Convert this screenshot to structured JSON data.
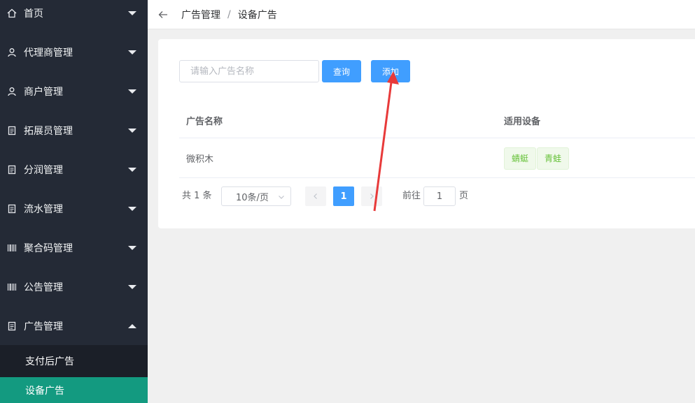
{
  "sidebar": {
    "items": [
      {
        "label": "首页",
        "icon": "home-icon",
        "expanded": false
      },
      {
        "label": "代理商管理",
        "icon": "user-icon",
        "expanded": false
      },
      {
        "label": "商户管理",
        "icon": "user-icon",
        "expanded": false
      },
      {
        "label": "拓展员管理",
        "icon": "document-icon",
        "expanded": false
      },
      {
        "label": "分润管理",
        "icon": "document-icon",
        "expanded": false
      },
      {
        "label": "流水管理",
        "icon": "document-icon",
        "expanded": false
      },
      {
        "label": "聚合码管理",
        "icon": "barcode-icon",
        "expanded": false
      },
      {
        "label": "公告管理",
        "icon": "barcode-icon",
        "expanded": false
      },
      {
        "label": "广告管理",
        "icon": "document-icon",
        "expanded": true
      }
    ],
    "subitems": [
      {
        "label": "支付后广告",
        "active": false
      },
      {
        "label": "设备广告",
        "active": true
      }
    ]
  },
  "header": {
    "breadcrumb": [
      "广告管理",
      "设备广告"
    ],
    "separator": "/"
  },
  "toolbar": {
    "search_placeholder": "请输入广告名称",
    "search_value": "",
    "query_label": "查询",
    "add_label": "添加"
  },
  "table": {
    "columns": [
      "广告名称",
      "适用设备"
    ],
    "rows": [
      {
        "name": "微积木",
        "devices": [
          "蜻蜓",
          "青蛙"
        ]
      }
    ]
  },
  "pagination": {
    "total_text": "共 1 条",
    "page_size": "10条/页",
    "current_page": "1",
    "goto_label": "前往",
    "goto_value": "1",
    "goto_suffix": "页"
  },
  "colors": {
    "sidebar_bg": "#242a36",
    "active_item": "#139a80",
    "primary": "#409eff",
    "tag_text": "#67c23a",
    "annotation_arrow": "#e83a3a"
  }
}
